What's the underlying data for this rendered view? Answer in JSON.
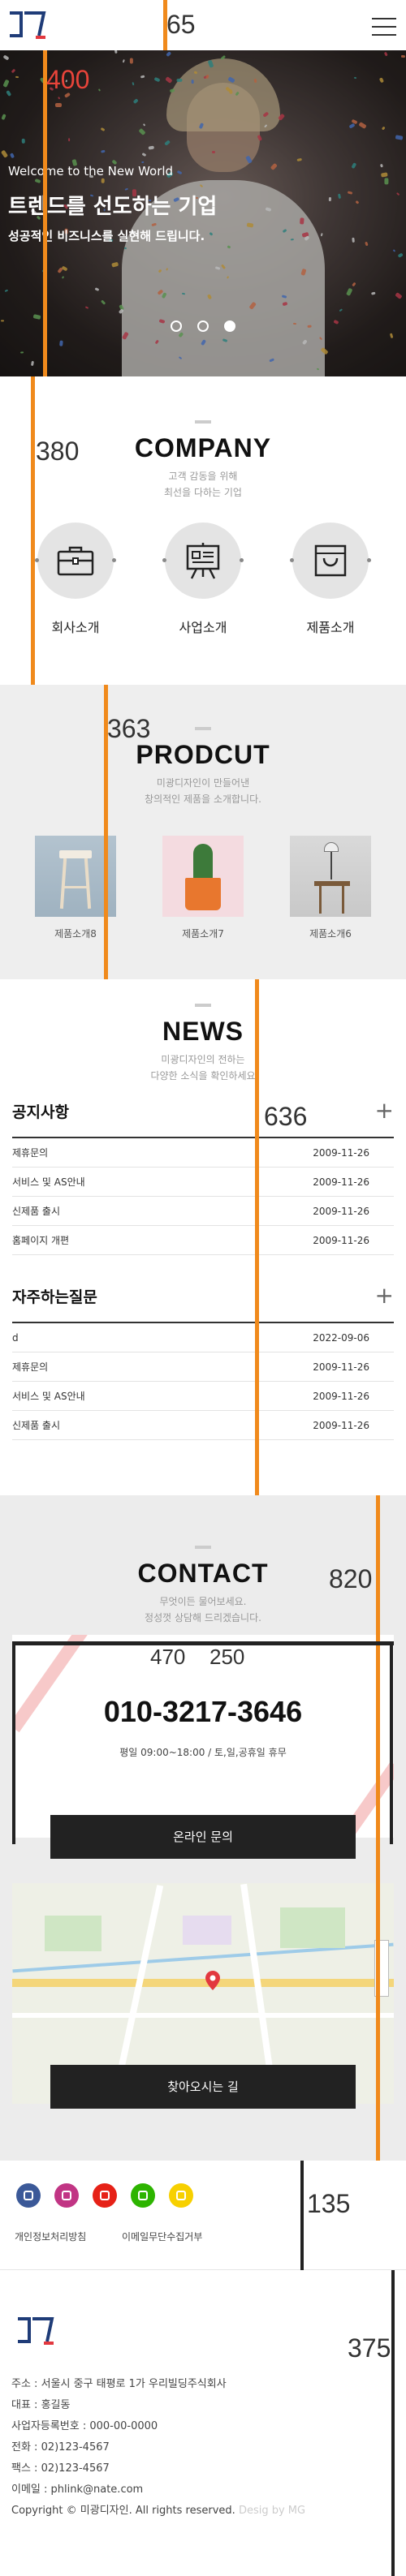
{
  "overlay": {
    "labels": [
      "65",
      "400",
      "380",
      "363",
      "636",
      "820",
      "470",
      "250",
      "135",
      "375"
    ]
  },
  "header": {
    "menu_icon": "hamburger-icon"
  },
  "hero": {
    "welcome": "Welcome to the New World",
    "headline": "트렌드를 선도하는 기업",
    "tagline": "성공적인 비즈니스를 실현해 드립니다.",
    "slides": 3,
    "active_slide": 3
  },
  "company": {
    "title": "COMPANY",
    "subtitle_1": "고객 감동을 위해",
    "subtitle_2": "최선을 다하는 기업",
    "items": [
      {
        "label": "회사소개",
        "icon": "briefcase-icon"
      },
      {
        "label": "사업소개",
        "icon": "presentation-board-icon"
      },
      {
        "label": "제품소개",
        "icon": "shopping-bag-icon"
      }
    ]
  },
  "product": {
    "title": "PRODCUT",
    "subtitle_1": "미광디자인이 만들어낸",
    "subtitle_2": "창의적인 제품을 소개합니다.",
    "items": [
      {
        "label": "제품소개8"
      },
      {
        "label": "제품소개7"
      },
      {
        "label": "제품소개6"
      }
    ]
  },
  "news": {
    "title": "NEWS",
    "subtitle_1": "미광디자인의 전하는",
    "subtitle_2": "다양한 소식을 확인하세요",
    "notice": {
      "title": "공지사항",
      "rows": [
        {
          "title": "제휴문의",
          "date": "2009-11-26"
        },
        {
          "title": "서비스 및 AS안내",
          "date": "2009-11-26"
        },
        {
          "title": "신제품 출시",
          "date": "2009-11-26"
        },
        {
          "title": "홈페이지 개편",
          "date": "2009-11-26"
        }
      ]
    },
    "faq": {
      "title": "자주하는질문",
      "rows": [
        {
          "title": "d",
          "date": "2022-09-06"
        },
        {
          "title": "제휴문의",
          "date": "2009-11-26"
        },
        {
          "title": "서비스 및 AS안내",
          "date": "2009-11-26"
        },
        {
          "title": "신제품 출시",
          "date": "2009-11-26"
        }
      ]
    }
  },
  "contact": {
    "title": "CONTACT",
    "subtitle_1": "무엇이든 물어보세요.",
    "subtitle_2": "정성껏 상담해 드리겠습니다.",
    "phone": "010-3217-3646",
    "hours": "평일 09:00~18:00 / 토,일,공휴일 휴무",
    "online_button": "온라인 문의",
    "map_button": "찾아오시는 길"
  },
  "footer": {
    "links": [
      "개인정보처리방침",
      "이메일무단수집거부"
    ],
    "sns": [
      {
        "icon": "facebook-icon",
        "color": "#3b5998"
      },
      {
        "icon": "instagram-icon",
        "color": "#c13584"
      },
      {
        "icon": "youtube-icon",
        "color": "#e62117"
      },
      {
        "icon": "blog-icon",
        "color": "#2db400"
      },
      {
        "icon": "kakaotalk-icon",
        "color": "#f7d000"
      }
    ],
    "address": "주소 : 서울시 중구 태평로 1가 우리빌딩주식회사",
    "ceo": "대표 : 홍길동",
    "biz_no": "사업자등록번호 : 000-00-0000",
    "tel": "전화 : 02)123-4567",
    "fax": "팩스 : 02)123-4567",
    "email": "이메일 : phlink@nate.com",
    "copyright": "Copyright © 미광디자인. All rights reserved.",
    "design_by": "Desig by MG"
  },
  "colors": {
    "accent": "#f08a1c",
    "dark": "#222222",
    "brand_blue": "#1f3c78",
    "brand_red": "#e2383f"
  }
}
